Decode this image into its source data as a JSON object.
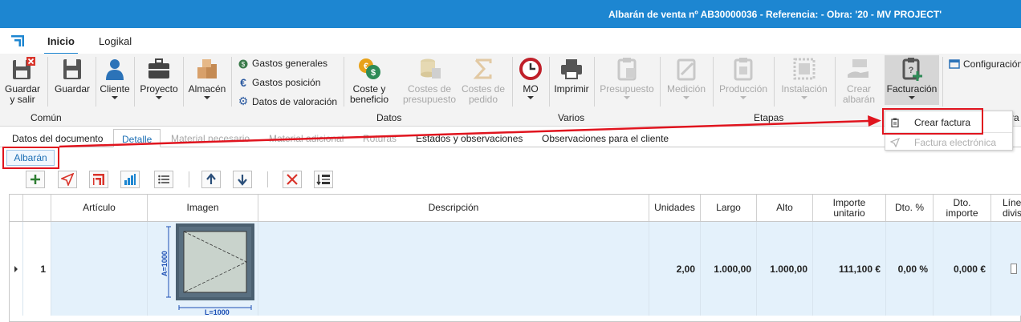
{
  "window_title": "Albarán de venta nº AB30000036 - Referencia:  - Obra: '20 - MV PROJECT'",
  "menu_tabs": [
    "Inicio",
    "Logikal"
  ],
  "ribbon": {
    "guardar_salir": [
      "Guardar",
      "y salir"
    ],
    "guardar": "Guardar",
    "comun_group": "Común",
    "cliente": "Cliente",
    "proyecto": "Proyecto",
    "almacen": "Almacén",
    "gastos_generales": "Gastos generales",
    "gastos_posicion": "Gastos posición",
    "datos_valoracion": "Datos de valoración",
    "coste_beneficio": [
      "Coste y",
      "beneficio"
    ],
    "costes_presupuesto": [
      "Costes de",
      "presupuesto"
    ],
    "costes_pedido": [
      "Costes de",
      "pedido"
    ],
    "datos_group": "Datos",
    "mo": "MO",
    "imprimir": "Imprimir",
    "varios_group": "Varios",
    "presupuesto": "Presupuesto",
    "medicion": "Medición",
    "produccion": "Producción",
    "instalacion": "Instalación",
    "crear_albaran": [
      "Crear",
      "albarán"
    ],
    "etapas_group": "Etapas",
    "facturacion": "Facturación",
    "configuracion": "Configuración",
    "facturacion_group_partial": "ra"
  },
  "dropdown": {
    "crear_factura": "Crear factura",
    "factura_electronica": "Factura electrónica"
  },
  "doc_tabs": [
    "Datos del documento",
    "Detalle",
    "Material necesario",
    "Material adicional",
    "Roturas",
    "Estados y observaciones",
    "Observaciones para el cliente"
  ],
  "sub_tab": "Albarán",
  "grid": {
    "headers": {
      "articulo": "Artículo",
      "imagen": "Imagen",
      "descripcion": "Descripción",
      "unidades": "Unidades",
      "largo": "Largo",
      "alto": "Alto",
      "importe_unitario": [
        "Importe",
        "unitario"
      ],
      "dto_pct": "Dto. %",
      "dto_importe": [
        "Dto.",
        "importe"
      ],
      "linea_division": [
        "Líne",
        "divisó"
      ]
    },
    "rows": [
      {
        "num": "1",
        "articulo": "",
        "descripcion": "",
        "unidades": "2,00",
        "largo": "1.000,00",
        "alto": "1.000,00",
        "importe_unitario": "111,100 €",
        "dto_pct": "0,00 %",
        "dto_importe": "0,000 €",
        "img_width_label": "L=1000",
        "img_height_label": "A=1000"
      }
    ]
  },
  "colors": {
    "title_bar": "#1d86d1",
    "highlight": "#e0141e",
    "row_selected": "#e4f1fb"
  }
}
